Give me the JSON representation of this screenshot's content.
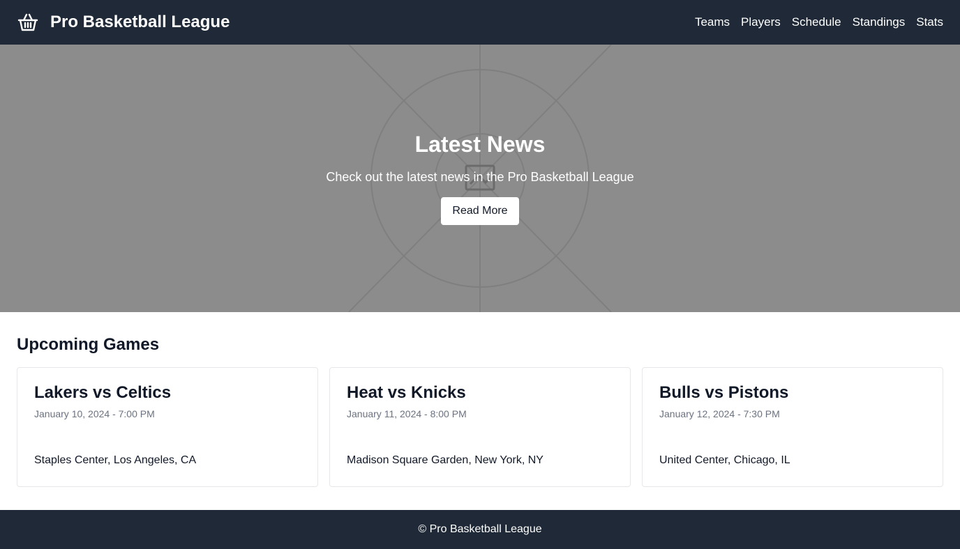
{
  "header": {
    "brand_icon": "basket-icon",
    "title": "Pro Basketball League",
    "nav": [
      {
        "label": "Teams"
      },
      {
        "label": "Players"
      },
      {
        "label": "Schedule"
      },
      {
        "label": "Standings"
      },
      {
        "label": "Stats"
      }
    ]
  },
  "hero": {
    "title": "Latest News",
    "subtitle": "Check out the latest news in the Pro Basketball League",
    "button_label": "Read More",
    "broken_image_icon": "broken-image-icon"
  },
  "games": {
    "section_title": "Upcoming Games",
    "items": [
      {
        "title": "Lakers vs Celtics",
        "datetime": "January 10, 2024 - 7:00 PM",
        "venue": "Staples Center, Los Angeles, CA"
      },
      {
        "title": "Heat vs Knicks",
        "datetime": "January 11, 2024 - 8:00 PM",
        "venue": "Madison Square Garden, New York, NY"
      },
      {
        "title": "Bulls vs Pistons",
        "datetime": "January 12, 2024 - 7:30 PM",
        "venue": "United Center, Chicago, IL"
      }
    ]
  },
  "footer": {
    "text": "© Pro Basketball League"
  },
  "colors": {
    "header_bg": "#1f2937",
    "hero_bg": "#8c8c8c",
    "footer_bg": "#1f2937"
  }
}
